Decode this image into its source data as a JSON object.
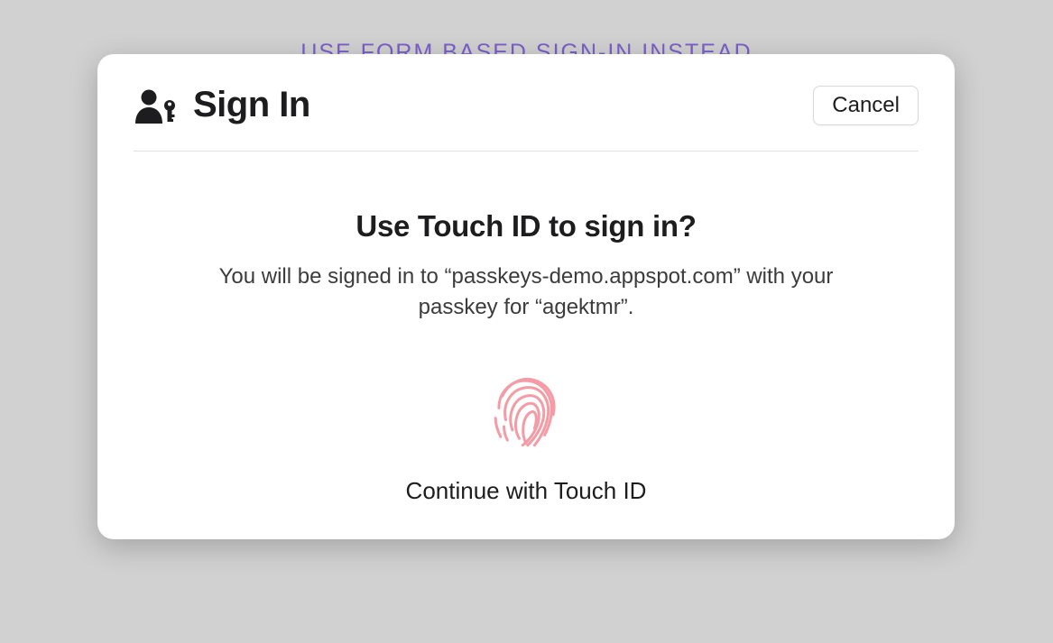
{
  "background": {
    "link_text": "USE FORM BASED SIGN-IN INSTEAD"
  },
  "modal": {
    "title": "Sign In",
    "cancel_label": "Cancel",
    "prompt_heading": "Use Touch ID to sign in?",
    "prompt_description": "You will be signed in to “passkeys-demo.appspot.com” with your passkey for “agektmr”.",
    "continue_label": "Continue with Touch ID"
  },
  "colors": {
    "link": "#7b5fc9",
    "fingerprint": "#f49ca5",
    "text_primary": "#1d1d1f",
    "modal_bg": "#ffffff",
    "page_bg": "#d1d1d1"
  }
}
